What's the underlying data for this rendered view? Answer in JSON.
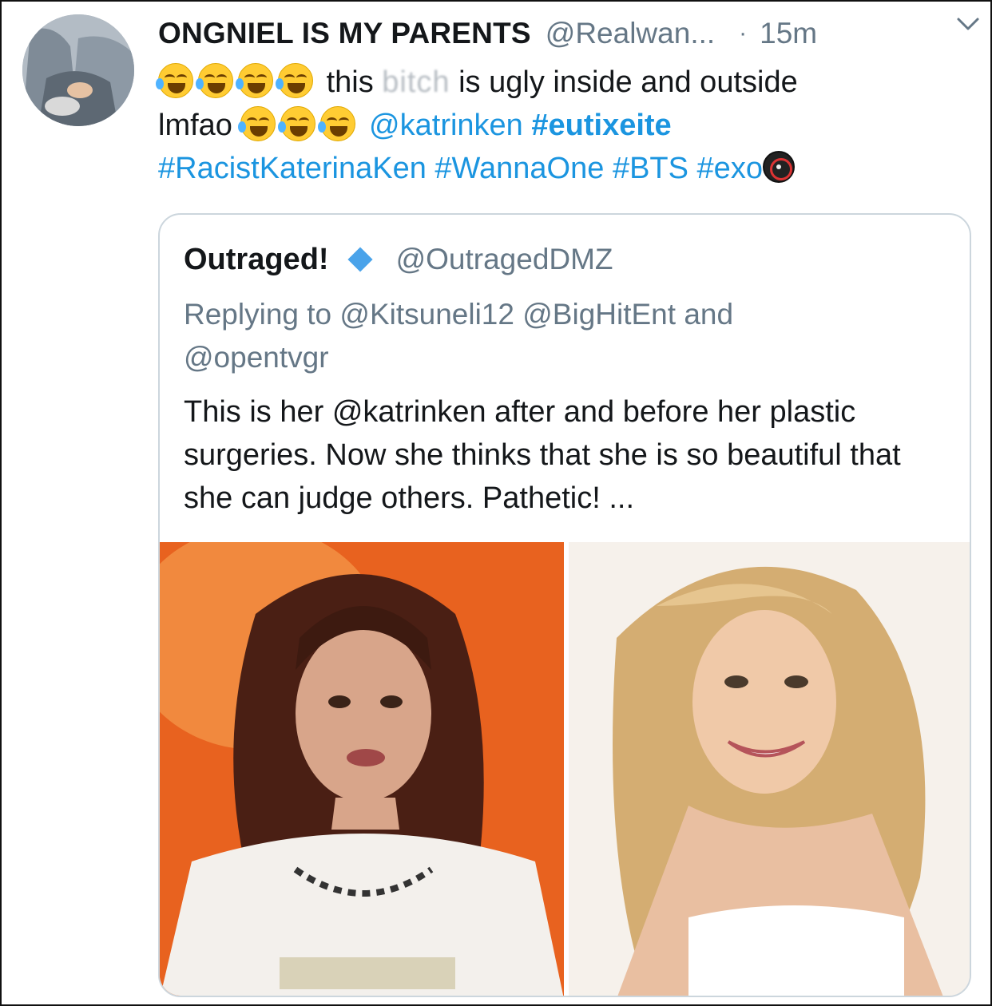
{
  "tweet": {
    "display_name": "ONGNIEL IS MY PARENTS",
    "handle": "@Realwan...",
    "separator": "·",
    "time": "15m",
    "text": {
      "part1": "this",
      "censored_word": "bitch",
      "part2": "is ugly inside and outside",
      "part3": "lmfao",
      "mention": "@katrinken",
      "hashtag_bold": "#eutixeite",
      "hashtags": [
        "#RacistKaterinaKen",
        "#WannaOne",
        "#BTS",
        "#exo"
      ]
    },
    "icons": {
      "avatar": "avatar-photo",
      "emoji": "face-with-tears-of-joy-icon",
      "exo_badge": "exo-hashflag-icon",
      "menu": "chevron-down-icon"
    }
  },
  "quoted_tweet": {
    "display_name": "Outraged!",
    "handle": "@OutragedDMZ",
    "reply_prefix": "Replying to",
    "reply_mentions": [
      "@Kitsuneli12",
      "@BigHitEnt",
      "and",
      "@opentvgr"
    ],
    "text_part1": "This is her",
    "mention": "@katrinken",
    "text_part2": "after and before her plastic surgeries. Now she thinks that she is so beautiful that she can judge others. Pathetic! ...",
    "images": [
      "before-photo",
      "after-photo"
    ]
  },
  "colors": {
    "link": "#1b95e0",
    "secondary_text": "#657786",
    "border": "#ccd6dd",
    "verified_diamond": "#4aa3ea"
  }
}
